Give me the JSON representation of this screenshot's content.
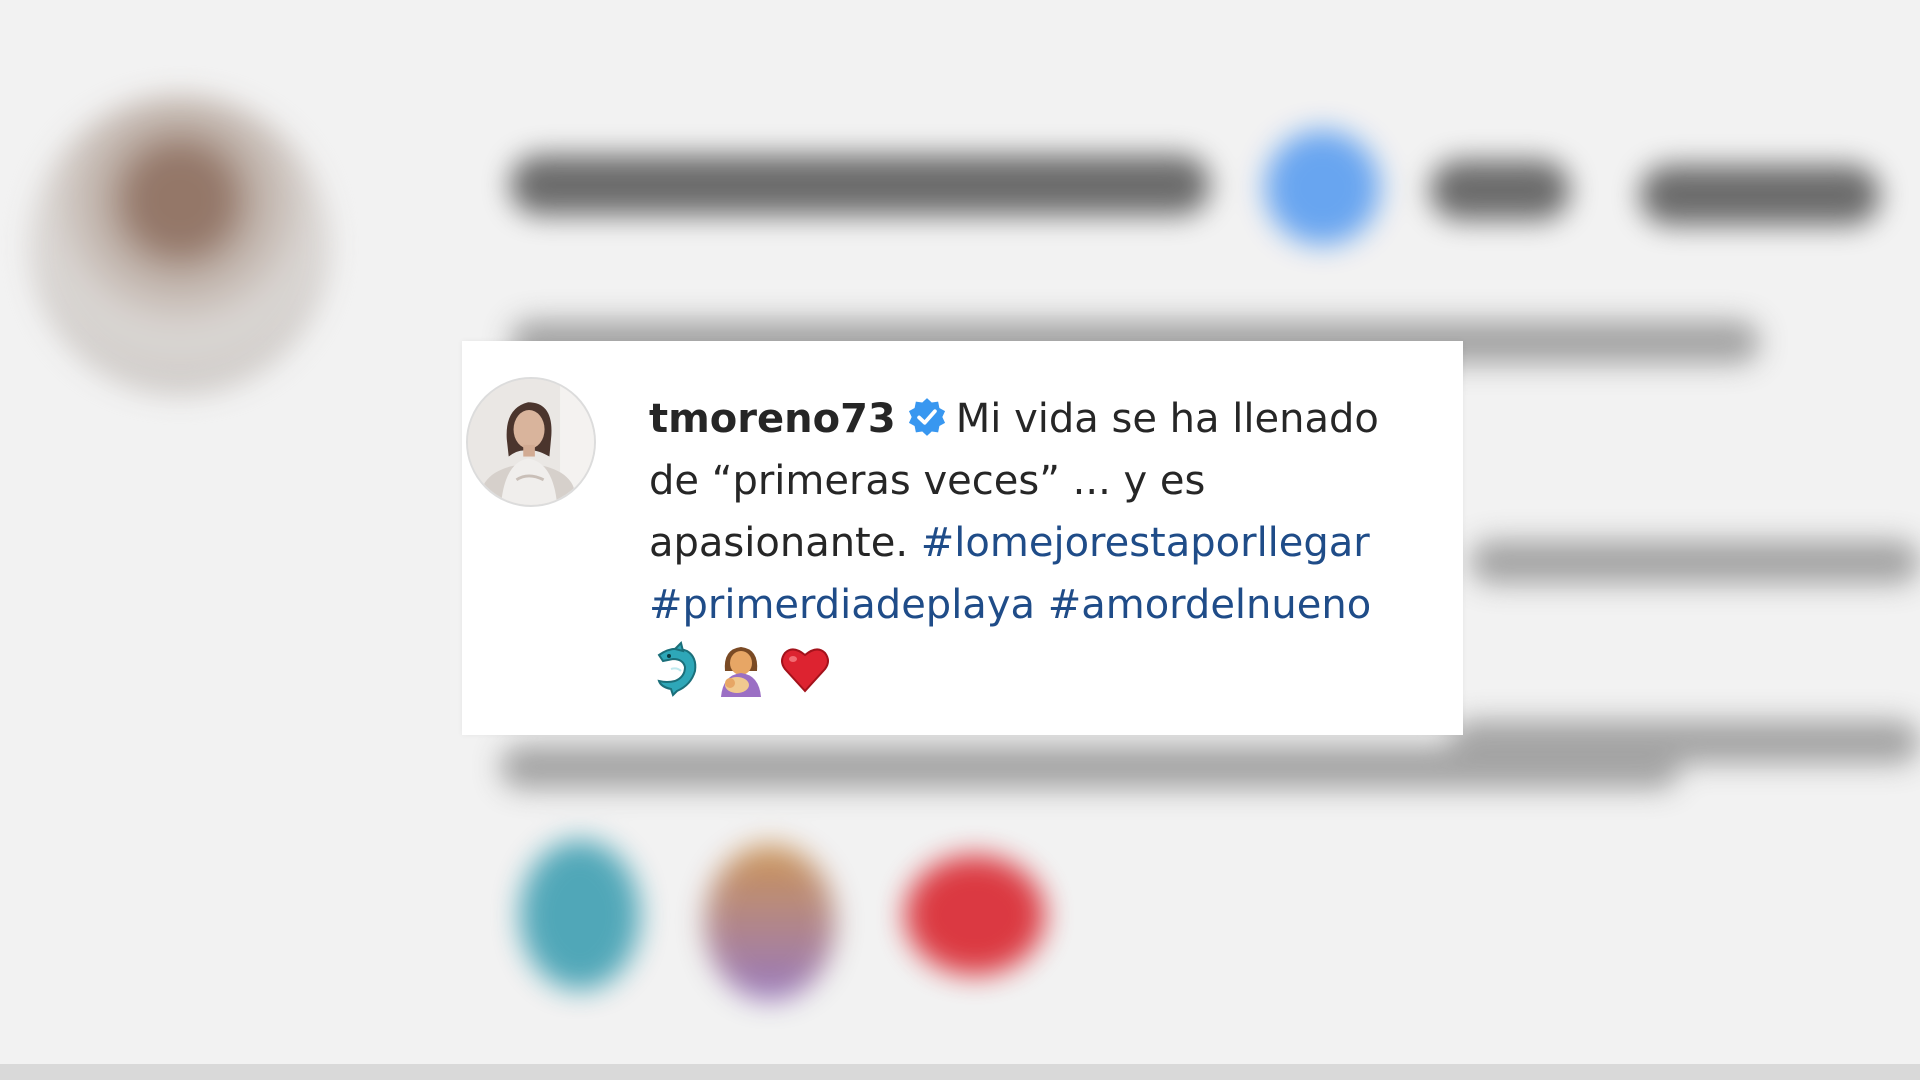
{
  "post": {
    "username": "tmoreno73",
    "verified": true,
    "caption_line1": "Mi vida se ha llenado",
    "caption_line2": "de “primeras veces” ... y es",
    "caption_line3": "apasionante.",
    "hashtags": [
      "#lomejorestaporllegar",
      "#primerdiadeplaya",
      "#amordelnueno"
    ],
    "emojis": [
      "dolphin-icon",
      "woman-feeding-baby-icon",
      "red-heart-icon"
    ]
  },
  "colors": {
    "hashtag": "#1f4c88",
    "verified_badge": "#3897f0",
    "text": "#262626",
    "card_background": "#ffffff"
  }
}
